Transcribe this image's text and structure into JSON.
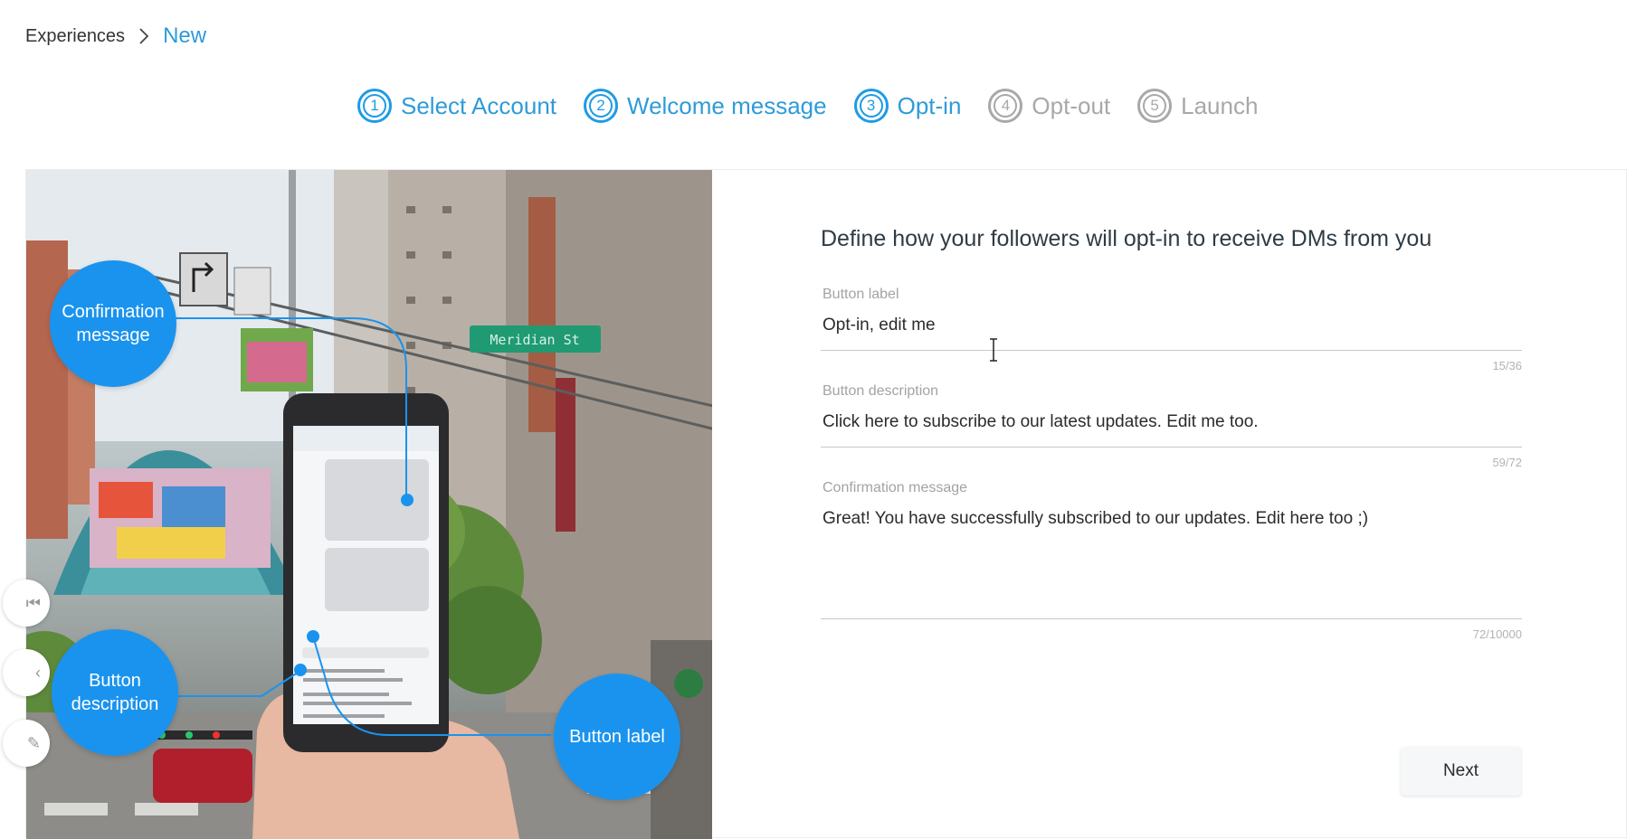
{
  "breadcrumb": {
    "root": "Experiences",
    "current": "New"
  },
  "steps": [
    {
      "number": "1",
      "label": "Select Account",
      "state": "active"
    },
    {
      "number": "2",
      "label": "Welcome message",
      "state": "active"
    },
    {
      "number": "3",
      "label": "Opt-in",
      "state": "active"
    },
    {
      "number": "4",
      "label": "Opt-out",
      "state": "inactive"
    },
    {
      "number": "5",
      "label": "Launch",
      "state": "inactive"
    }
  ],
  "illustration": {
    "bubbles": {
      "confirmation": "Confirmation message",
      "description": "Button description",
      "label": "Button label"
    },
    "street_sign": "Meridian St"
  },
  "form": {
    "title": "Define how your followers will opt-in to receive DMs from you",
    "button_label": {
      "label": "Button label",
      "value": "Opt-in, edit me",
      "count": "15/36"
    },
    "button_description": {
      "label": "Button description",
      "value": "Click here to subscribe to our latest updates. Edit me too.",
      "count": "59/72"
    },
    "confirmation_message": {
      "label": "Confirmation message",
      "value": "Great! You have successfully subscribed to our updates. Edit here too ;)",
      "count": "72/10000"
    }
  },
  "actions": {
    "next": "Next"
  },
  "colors": {
    "accent": "#1e9be6",
    "bubble": "#1a93ee",
    "inactive": "#a8a8a8"
  }
}
